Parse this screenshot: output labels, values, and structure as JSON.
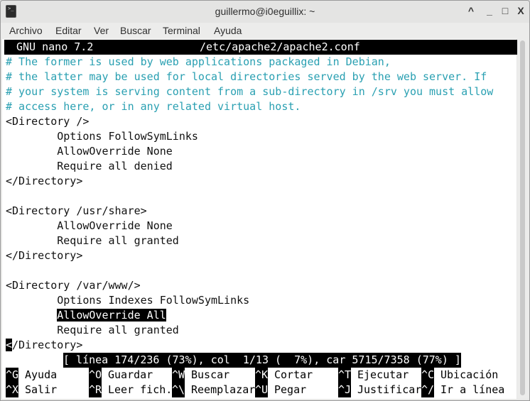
{
  "window": {
    "title": "guillermo@i0eguillix: ~",
    "controls": [
      "^",
      "_",
      "□",
      "X"
    ]
  },
  "menubar": [
    "Archivo",
    "Editar",
    "Ver",
    "Buscar",
    "Terminal",
    "Ayuda"
  ],
  "nano": {
    "version": "GNU nano 7.2",
    "filename": "/etc/apache2/apache2.conf",
    "lines": [
      {
        "text": "# The former is used by web applications packaged in Debian,",
        "type": "comment"
      },
      {
        "text": "# the latter may be used for local directories served by the web server. If",
        "type": "comment"
      },
      {
        "text": "# your system is serving content from a sub-directory in /srv you must allow",
        "type": "comment"
      },
      {
        "text": "# access here, or in any related virtual host.",
        "type": "comment"
      },
      {
        "text": "<Directory />",
        "type": "code"
      },
      {
        "text": "        Options FollowSymLinks",
        "type": "code"
      },
      {
        "text": "        AllowOverride None",
        "type": "code"
      },
      {
        "text": "        Require all denied",
        "type": "code"
      },
      {
        "text": "</Directory>",
        "type": "code"
      },
      {
        "text": "",
        "type": "code"
      },
      {
        "text": "<Directory /usr/share>",
        "type": "code"
      },
      {
        "text": "        AllowOverride None",
        "type": "code"
      },
      {
        "text": "        Require all granted",
        "type": "code"
      },
      {
        "text": "</Directory>",
        "type": "code"
      },
      {
        "text": "",
        "type": "code"
      },
      {
        "text": "<Directory /var/www/>",
        "type": "code"
      },
      {
        "text": "        Options Indexes FollowSymLinks",
        "type": "code"
      },
      {
        "text": "        AllowOverride All",
        "type": "highlight"
      },
      {
        "text": "        Require all granted",
        "type": "code"
      },
      {
        "text": "</Directory>",
        "type": "cursor"
      }
    ],
    "status": "[ línea 174/236 (73%), col  1/13 (  7%), car 5715/7358 (77%) ]",
    "shortcuts": [
      [
        {
          "key": "^G",
          "label": "Ayuda"
        },
        {
          "key": "^O",
          "label": "Guardar"
        },
        {
          "key": "^W",
          "label": "Buscar"
        },
        {
          "key": "^K",
          "label": "Cortar"
        },
        {
          "key": "^T",
          "label": "Ejecutar"
        },
        {
          "key": "^C",
          "label": "Ubicación"
        }
      ],
      [
        {
          "key": "^X",
          "label": "Salir"
        },
        {
          "key": "^R",
          "label": "Leer fich."
        },
        {
          "key": "^\\",
          "label": "Reemplazar"
        },
        {
          "key": "^U",
          "label": "Pegar"
        },
        {
          "key": "^J",
          "label": "Justificar"
        },
        {
          "key": "^/",
          "label": "Ir a línea"
        }
      ]
    ]
  },
  "colors": {
    "comment": "#2aa0b2",
    "background": "#ffffff",
    "inverse": "#000000"
  }
}
